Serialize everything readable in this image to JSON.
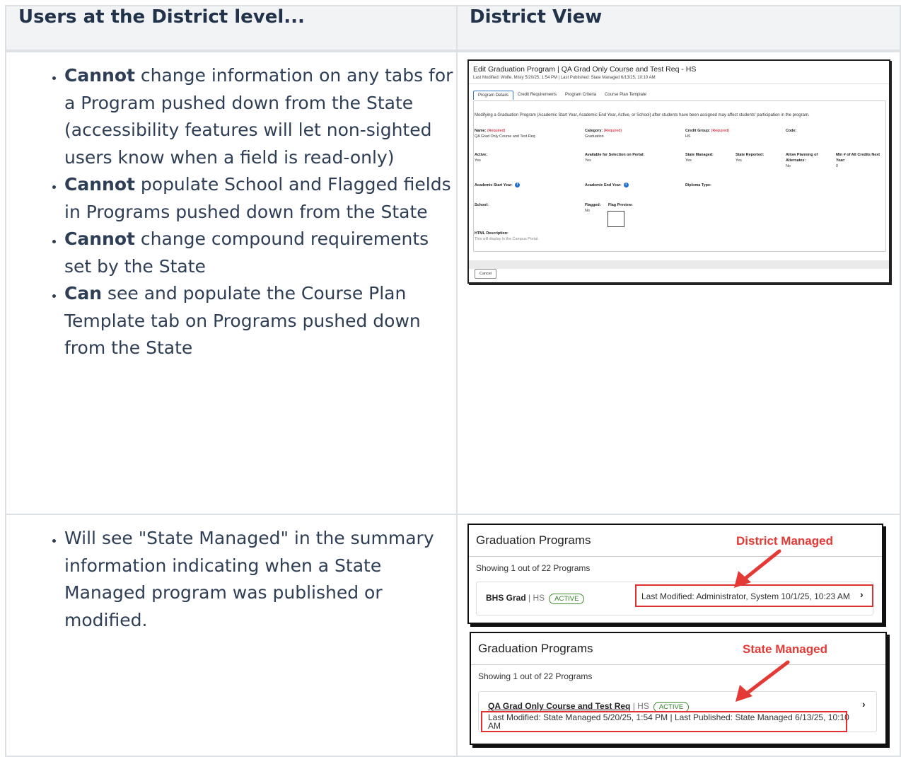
{
  "table": {
    "header_left": "Users at the District level...",
    "header_right": "District View"
  },
  "row1": {
    "items": [
      {
        "bold": "Cannot",
        "text": " change information on any tabs for a Program pushed down from the State (accessibility features will let non-sighted users know when a field is read-only)"
      },
      {
        "bold": "Cannot",
        "text": " populate School and Flagged fields in Programs pushed down from the State"
      },
      {
        "bold": "Cannot",
        "text": " change compound requirements set by the State"
      },
      {
        "bold": "Can",
        "text": " see and populate the Course Plan Template tab on Programs pushed down from the State"
      }
    ]
  },
  "row2": {
    "items": [
      {
        "text": "Will see \"State Managed\" in the summary information indicating when a State Managed program was published or modified."
      }
    ]
  },
  "screenshot1": {
    "title": "Edit Graduation Program | QA Grad Only Course and Test Req - HS",
    "meta": "Last Modified: Wolfe, Misty 5/20/25, 1:54 PM  |  Last Published: State Managed 6/13/25, 10:10 AM",
    "tabs": [
      "Program Details",
      "Credit Requirements",
      "Program Criteria",
      "Course Plan Template"
    ],
    "note": "Modifying a Graduation Program (Academic Start Year, Academic End Year, Active, or School) after students have been assigned may affect students' participation in the program.",
    "required": "(Required)",
    "fields": {
      "name_label": "Name:",
      "name_value": "QA Grad Only Course and Test Req",
      "category_label": "Category:",
      "category_value": "Graduation",
      "credit_group_label": "Credit Group:",
      "credit_group_value": "HS",
      "code_label": "Code:",
      "active_label": "Active:",
      "active_value": "Yes",
      "portal_label": "Available for Selection on Portal:",
      "portal_value": "Yes",
      "state_managed_label": "State Managed:",
      "state_managed_value": "Yes",
      "state_reported_label": "State Reported:",
      "state_reported_value": "Yes",
      "allow_planning_label": "Allow Planning of Alternates:",
      "allow_planning_value": "No",
      "min_alt_label": "Min # of Alt Credits Next Year:",
      "min_alt_value": "0",
      "start_year_label": "Academic Start Year:",
      "end_year_label": "Academic End Year:",
      "diploma_label": "Diploma Type:",
      "school_label": "School:",
      "flagged_label": "Flagged:",
      "flagged_value": "No",
      "flag_preview_label": "Flag Preview:",
      "html_desc_label": "HTML Description:",
      "html_desc_hint": "This will display in the Campus Portal."
    },
    "cancel": "Cancel"
  },
  "screenshot2": {
    "title": "Graduation Programs",
    "callout": "District Managed",
    "showing": "Showing 1 out of 22 Programs",
    "program_name": "BHS Grad",
    "program_sub": " | HS",
    "badge": "ACTIVE",
    "info": "Last Modified: Administrator, System 10/1/25, 10:23 AM",
    "chevron": "›"
  },
  "screenshot3": {
    "title": "Graduation Programs",
    "callout": "State Managed",
    "showing": "Showing 1 out of 22 Programs",
    "program_name": "QA Grad Only Course and Test Req",
    "program_sub": " | HS",
    "badge": "ACTIVE",
    "info_line1": "Last Modified: State Managed 5/20/25, 1:54 PM   |   Last Published: State Managed 6/13/25, 10:10",
    "info_line2": "AM",
    "chevron": "›"
  },
  "colors": {
    "callout_red": "#e53935",
    "link_blue": "#3a78c8",
    "badge_green": "#2e7d22"
  },
  "icons": [
    "info-icon",
    "arrow-icon",
    "chevron-right-icon"
  ]
}
